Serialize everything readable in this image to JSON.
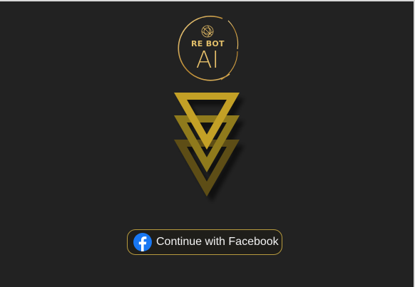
{
  "logo": {
    "brand_top": "RE BOT",
    "brand_bottom": "AI",
    "icon": "spiral-emblem-icon",
    "ring_color": "#c9a048"
  },
  "hero": {
    "icon": "stacked-triangles-icon",
    "colors": [
      "#c3a027",
      "#8f7a1c",
      "#5d4e12"
    ]
  },
  "facebook_button": {
    "label": "Continue with Facebook",
    "icon": "facebook-icon",
    "icon_color": "#1877f2"
  },
  "colors": {
    "background": "#222222",
    "accent_gold": "#c9a048"
  }
}
